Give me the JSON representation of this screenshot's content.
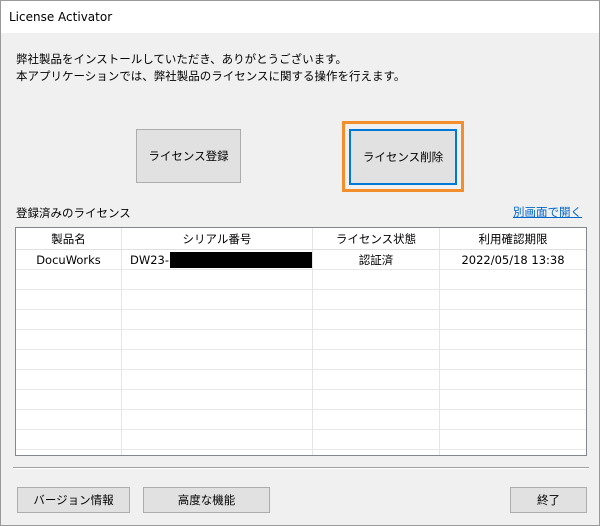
{
  "window": {
    "title": "License Activator"
  },
  "intro": {
    "line1": "弊社製品をインストールしていただき、ありがとうございます。",
    "line2": "本アプリケーションでは、弊社製品のライセンスに関する操作を行えます。"
  },
  "actions": {
    "register_label": "ライセンス登録",
    "delete_label": "ライセンス削除"
  },
  "licenses": {
    "section_label": "登録済みのライセンス",
    "open_link": "別画面で開く",
    "columns": [
      "製品名",
      "シリアル番号",
      "ライセンス状態",
      "利用確認期限"
    ],
    "rows": [
      {
        "product": "DocuWorks",
        "serial_prefix": "DW23-",
        "status": "認証済",
        "expiry": "2022/05/18 13:38"
      }
    ]
  },
  "footer": {
    "version_label": "バージョン情報",
    "advanced_label": "高度な機能",
    "exit_label": "終了"
  },
  "colors": {
    "focus_blue": "#0078d7",
    "highlight_orange": "#f28e2b",
    "link_blue": "#0066cc"
  }
}
